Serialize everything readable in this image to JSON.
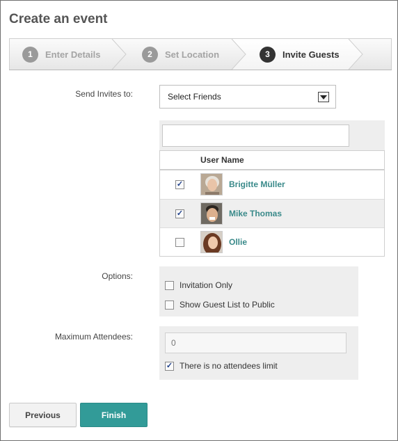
{
  "page": {
    "title": "Create an event"
  },
  "wizard": {
    "steps": [
      {
        "number": "1",
        "label": "Enter Details",
        "state": "inactive"
      },
      {
        "number": "2",
        "label": "Set Location",
        "state": "inactive"
      },
      {
        "number": "3",
        "label": "Invite Guests",
        "state": "active"
      }
    ]
  },
  "invites": {
    "label": "Send Invites to:",
    "select_value": "Select Friends",
    "search_value": "",
    "column_header": "User Name",
    "users": [
      {
        "name": "Brigitte Müller",
        "checked": true,
        "avatar": "avatar-icon"
      },
      {
        "name": "Mike Thomas",
        "checked": true,
        "avatar": "avatar-icon"
      },
      {
        "name": "Ollie",
        "checked": false,
        "avatar": "avatar-icon"
      }
    ]
  },
  "options": {
    "label": "Options:",
    "items": [
      {
        "label": "Invitation Only",
        "checked": false
      },
      {
        "label": "Show Guest List to Public",
        "checked": false
      }
    ]
  },
  "attendees": {
    "label": "Maximum Attendees:",
    "placeholder": "0",
    "no_limit_label": "There is no attendees limit",
    "no_limit_checked": true
  },
  "buttons": {
    "previous": "Previous",
    "finish": "Finish"
  },
  "colors": {
    "accent": "#329b98",
    "link": "#3a8a8a",
    "panel_bg": "#eeeeee"
  }
}
